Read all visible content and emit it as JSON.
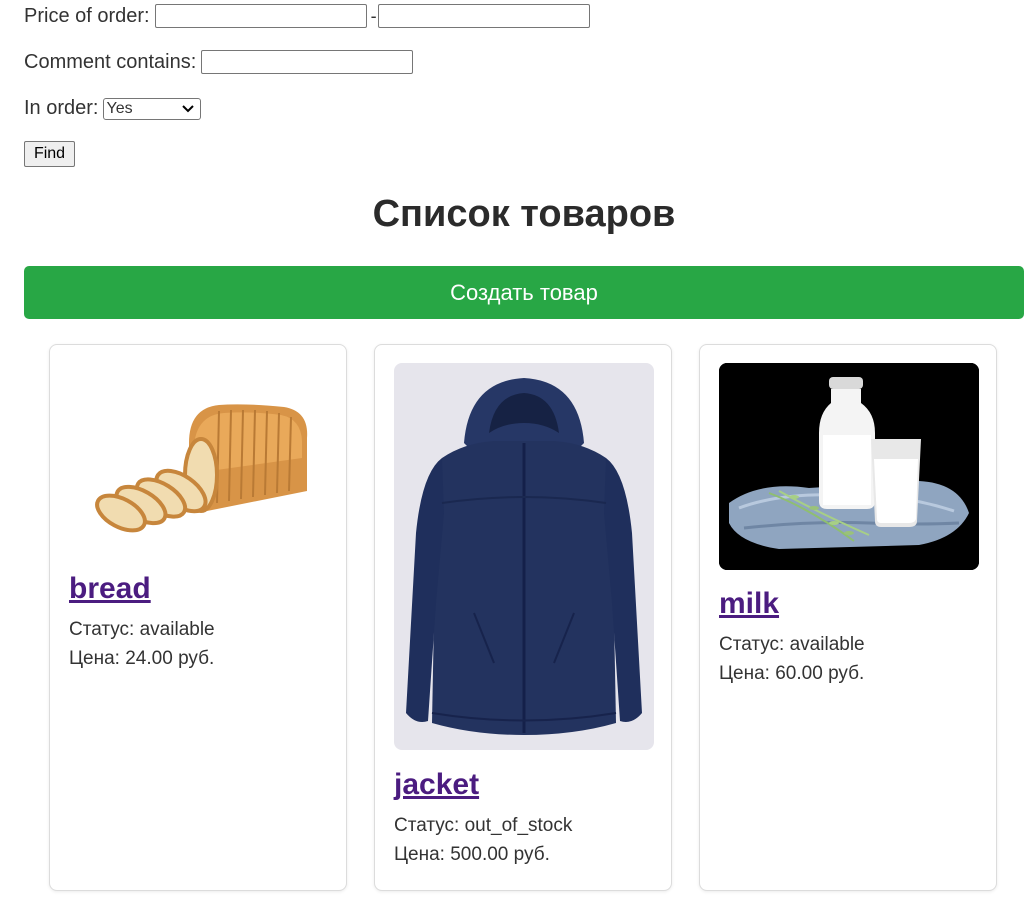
{
  "filters": {
    "price_label": "Price of order:",
    "price_separator": "-",
    "price_from_value": "",
    "price_to_value": "",
    "comment_label": "Comment contains:",
    "comment_value": "",
    "in_order_label": "In order:",
    "in_order_selected": "Yes",
    "find_label": "Find"
  },
  "page": {
    "title": "Список товаров",
    "create_button": "Создать товар"
  },
  "products": [
    {
      "name": "bread",
      "status": "Статус: available",
      "price": "Цена: 24.00 руб."
    },
    {
      "name": "jacket",
      "status": "Статус: out_of_stock",
      "price": "Цена: 500.00 руб."
    },
    {
      "name": "milk",
      "status": "Статус: available",
      "price": "Цена: 60.00 руб."
    }
  ],
  "colors": {
    "create_button_bg": "#28a745",
    "link": "#4b1c80",
    "jacket_image_bg": "#e6e5ec",
    "milk_image_bg": "#000000",
    "jacket": "#1f2f5c"
  }
}
